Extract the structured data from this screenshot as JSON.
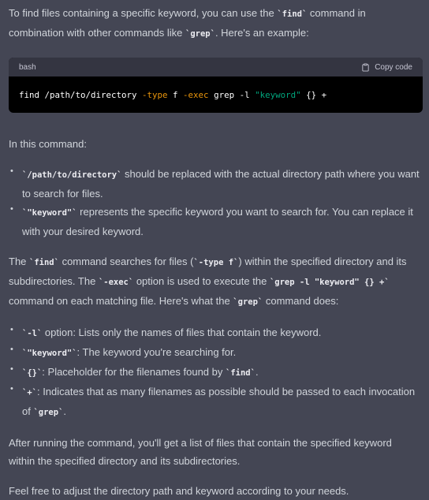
{
  "intro": {
    "t1": "To find files containing a specific keyword, you can use the ",
    "c1": "`find`",
    "t2": " command in combination with other commands like ",
    "c2": "`grep`",
    "t3": ". Here's an example:"
  },
  "codeblock": {
    "language": "bash",
    "copy_label": "Copy code",
    "tokens": {
      "a": "find /path/to/directory ",
      "b": "-type",
      "c": " f ",
      "d": "-exec",
      "e": " grep -l ",
      "f": "\"keyword\"",
      "g": " {} +"
    }
  },
  "in_this_command": "In this command:",
  "list1": [
    {
      "code": "`/path/to/directory`",
      "text": " should be replaced with the actual directory path where you want to search for files."
    },
    {
      "code": "`\"keyword\"`",
      "text": " represents the specific keyword you want to search for. You can replace it with your desired keyword."
    }
  ],
  "explanation": {
    "t1": "The ",
    "c1": "`find`",
    "t2": " command searches for files (",
    "c2": "`-type f`",
    "t3": ") within the specified directory and its subdirectories. The ",
    "c3": "`-exec`",
    "t4": " option is used to execute the ",
    "c4": "`grep -l \"keyword\" {} +`",
    "t5": " command on each matching file. Here's what the ",
    "c5": "`grep`",
    "t6": " command does:"
  },
  "list2": [
    {
      "code": "`-l`",
      "text": " option: Lists only the names of files that contain the keyword."
    },
    {
      "code": "`\"keyword\"`",
      "text": ": The keyword you're searching for."
    },
    {
      "code": "`{}`",
      "text": ": Placeholder for the filenames found by ",
      "code2": "`find`",
      "text2": "."
    },
    {
      "code": "`+`",
      "text": ": Indicates that as many filenames as possible should be passed to each invocation of ",
      "code2": "`grep`",
      "text2": "."
    }
  ],
  "after": "After running the command, you'll get a list of files that contain the specified keyword within the specified directory and its subdirectories.",
  "closing": "Feel free to adjust the directory path and keyword according to your needs."
}
